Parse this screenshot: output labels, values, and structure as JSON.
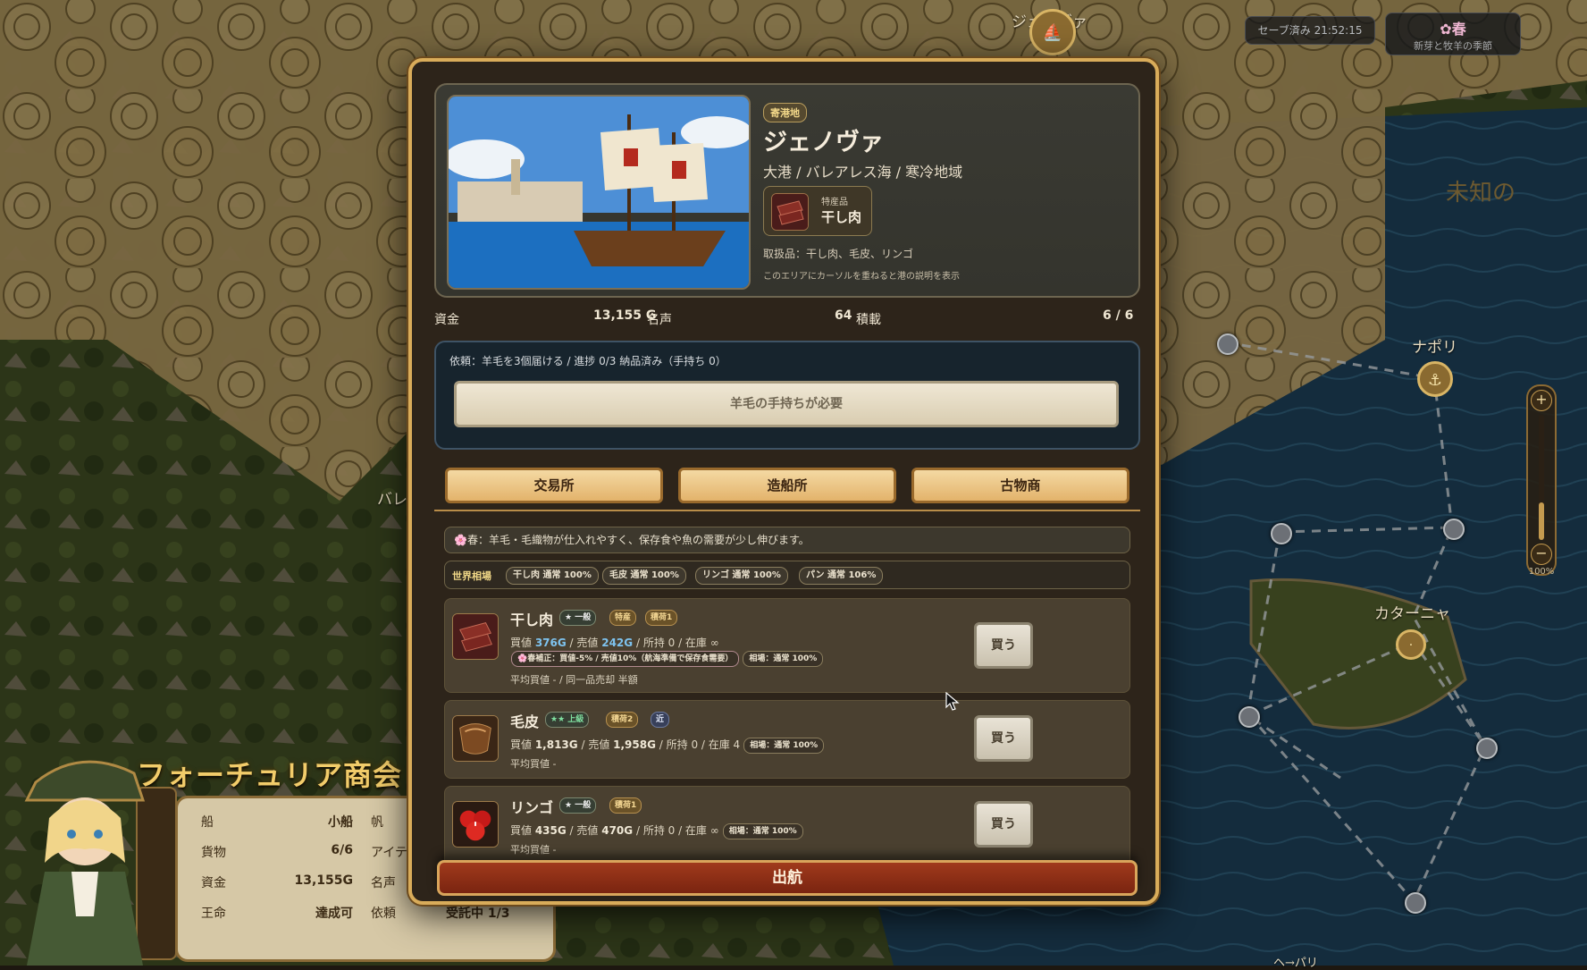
{
  "map": {
    "label_genova": "ジェノヴァ",
    "label_napoli": "ナポリ",
    "label_catania": "カターニャ",
    "label_unknown": "未知の",
    "label_baleares": "バレ",
    "label_bottom": "ヘ→パリ"
  },
  "topbar": {
    "save_status": "セーブ済み 21:52:15",
    "season_title": "春",
    "season_desc": "新芽と牧羊の季節"
  },
  "zoom": {
    "plus": "+",
    "minus": "−",
    "level_label": "100%",
    "level": 0.3
  },
  "guild": {
    "name": "フォーチュリア商会",
    "rows": [
      {
        "key": "船",
        "value": "小船"
      },
      {
        "key": "貨物",
        "value": "6/6"
      },
      {
        "key": "資金",
        "value": "13,155G"
      },
      {
        "key": "王命",
        "value": "達成可"
      }
    ],
    "col2": [
      "帆",
      "アイテ",
      "名声",
      "依頼"
    ],
    "col2_value": "受託中 1/3"
  },
  "port": {
    "badge": "寄港地",
    "name": "ジェノヴァ",
    "subtitle": "大港 / バレアレス海 / 寒冷地域",
    "specialty_label": "特産品",
    "specialty_value": "干し肉",
    "trade_goods": "取扱品：干し肉、毛皮、リンゴ",
    "hint": "このエリアにカーソルを重ねると港の説明を表示"
  },
  "stats": {
    "funds_label": "資金",
    "funds_value": "13,155 G",
    "fame_label": "名声",
    "fame_value": "64",
    "cargo_label": "積載",
    "cargo_value": "6 / 6"
  },
  "quest": {
    "text": "依頼：羊毛を3個届ける / 進捗 0/3 納品済み（手持ち 0）",
    "button": "羊毛の手持ちが必要"
  },
  "tabs": [
    "交易所",
    "造船所",
    "古物商"
  ],
  "season_note": "🌸春：羊毛・毛織物が仕入れやすく、保存食や魚の需要が少し伸びます。",
  "market": {
    "label": "世界相場",
    "pills": [
      "干し肉 通常 100%",
      "毛皮 通常 100%",
      "リンゴ 通常 100%",
      "パン 通常 106%"
    ]
  },
  "goods": [
    {
      "name": "干し肉",
      "tags": [
        "★ 一般",
        "特産",
        "積荷1"
      ],
      "buy_label": "買値 ",
      "buy": "376G",
      "sell_label": " / 売値 ",
      "sell": "242G",
      "rest": " / 所持 0 / 在庫 ∞",
      "mods": [
        "🌸春補正：買値-5% / 売値10%（航海準備で保存食需要）",
        "相場：通常 100%"
      ],
      "avg": "平均買値 - / 同一品売却 半額",
      "button": "買う"
    },
    {
      "name": "毛皮",
      "tags": [
        "★★ 上級",
        "積荷2",
        "近"
      ],
      "buy_label": "買値 ",
      "buy": "1,813G",
      "sell_label": " / 売値 ",
      "sell": "1,958G",
      "rest": " / 所持 0 / 在庫 4",
      "mods": [
        "相場：通常 100%"
      ],
      "avg": "平均買値 -",
      "button": "買う"
    },
    {
      "name": "リンゴ",
      "tags": [
        "★ 一般",
        "積荷1"
      ],
      "buy_label": "買値 ",
      "buy": "435G",
      "sell_label": " / 売値 ",
      "sell": "470G",
      "rest": " / 所持 0 / 在庫 ∞",
      "mods": [
        "相場：通常 100%"
      ],
      "avg": "平均買値 -",
      "button": "買う"
    }
  ],
  "depart": "出航",
  "colors": {
    "accent": "#d9ac5a",
    "depart": "#a03a1c",
    "price": "#7ec3ef"
  },
  "icons": [
    "cloud-icon",
    "anchor-icon",
    "ship-icon",
    "jerky-icon",
    "fur-icon",
    "apple-icon",
    "cursor-icon"
  ]
}
